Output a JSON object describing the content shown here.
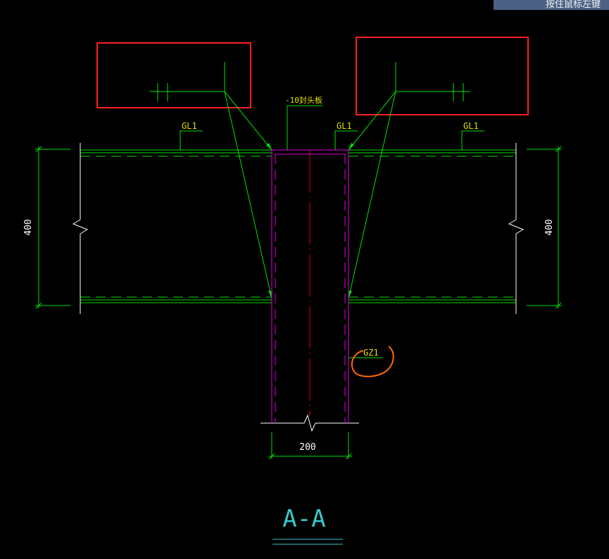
{
  "tooltip": "按住鼠标左键",
  "labels": {
    "plate": "-10封头板",
    "beam_left": "GL1",
    "beam_mid": "GL1",
    "beam_right": "GL1",
    "column": "GZ1",
    "dim_left": "400",
    "dim_right": "400",
    "dim_bottom": "200",
    "section_title": "A-A"
  },
  "colors": {
    "background": "#000000",
    "green": "#00e000",
    "magenta": "#e000e0",
    "red_line": "#e00000",
    "highlight_box": "#ff2020",
    "annotation": "#ff6a00",
    "white": "#ffffff",
    "title": "#38c8c8"
  }
}
